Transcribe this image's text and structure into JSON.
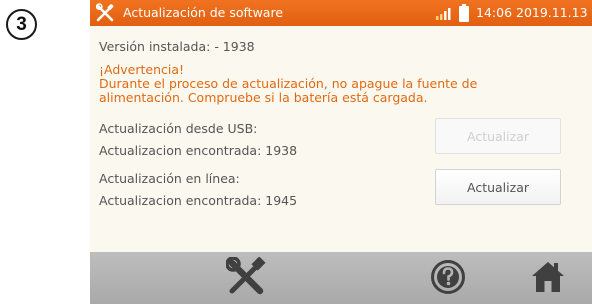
{
  "step": "3",
  "header": {
    "title": "Actualización de software",
    "clock": "14:06 2019.11.13",
    "icons": [
      "tools-icon",
      "signal-icon",
      "battery-icon"
    ]
  },
  "content": {
    "installed_version": "Versión instalada: - 1938",
    "warning_title": "¡Advertencia!",
    "warning_line1": "Durante el proceso de actualización, no apague la fuente de",
    "warning_line2": "alimentación. Compruebe si la batería está cargada.",
    "usb_label": "Actualización desde USB:",
    "usb_found": "Actualizacion encontrada: 1938",
    "usb_button": "Actualizar",
    "online_label": "Actualización en línea:",
    "online_found": "Actualizacion encontrada: 1945",
    "online_button": "Actualizar"
  },
  "bottom_bar": {
    "icons": [
      "settings-tools-icon",
      "help-icon",
      "home-icon"
    ]
  },
  "colors": {
    "accent": "#e8671a",
    "warning_text": "#e06a12",
    "bottom_bar": "#b3b3b3"
  }
}
